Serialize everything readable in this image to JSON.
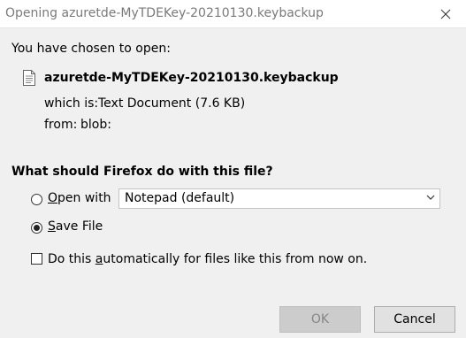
{
  "window": {
    "title": "Opening azuretde-MyTDEKey-20210130.keybackup"
  },
  "dialog": {
    "intro": "You have chosen to open:",
    "file_name": "azuretde-MyTDEKey-20210130.keybackup",
    "which_is_label": "which is:",
    "which_is_value": "Text Document (7.6 KB)",
    "from_label": "from:",
    "from_value": "blob:",
    "question": "What should Firefox do with this file?",
    "open_with": {
      "accesskey": "O",
      "rest": "pen with",
      "selected": false
    },
    "application_select": {
      "value": "Notepad (default)"
    },
    "save_file": {
      "accesskey": "S",
      "rest": "ave File",
      "selected": true
    },
    "auto_checkbox": {
      "pre": "Do this ",
      "accesskey": "a",
      "post": "utomatically for files like this from now on.",
      "checked": false
    }
  },
  "buttons": {
    "ok_label": "OK",
    "ok_enabled": false,
    "cancel_label": "Cancel"
  }
}
